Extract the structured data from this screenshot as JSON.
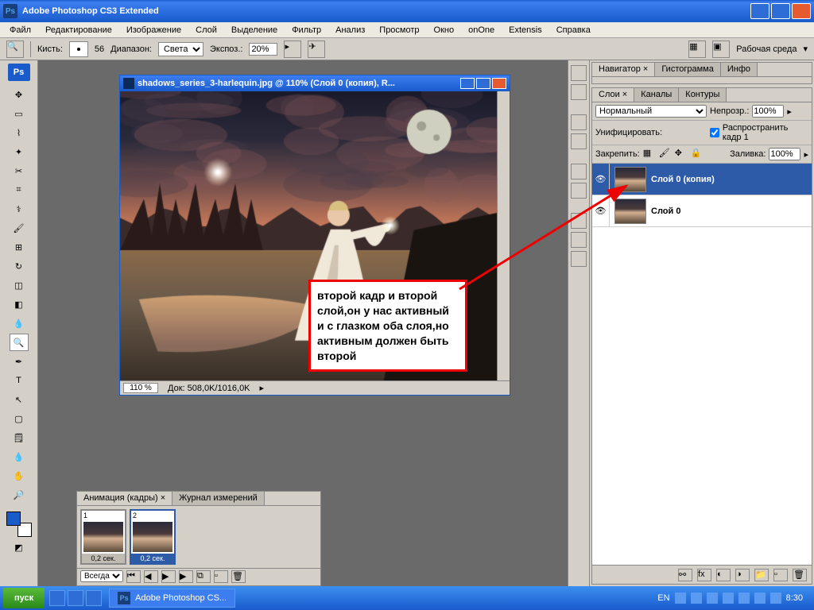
{
  "titlebar": {
    "app_name": "Adobe Photoshop CS3 Extended"
  },
  "menu": [
    "Файл",
    "Редактирование",
    "Изображение",
    "Слой",
    "Выделение",
    "Фильтр",
    "Анализ",
    "Просмотр",
    "Окно",
    "onOne",
    "Extensis",
    "Справка"
  ],
  "options": {
    "brush_label": "Кисть:",
    "brush_size": "56",
    "range_label": "Диапазон:",
    "range_value": "Света",
    "exposure_label": "Экспоз.:",
    "exposure_value": "20%",
    "workspace": "Рабочая среда"
  },
  "doc": {
    "title": "shadows_series_3-harlequin.jpg @ 110% (Слой 0 (копия), R...",
    "zoom": "110 %",
    "status": "Док: 508,0K/1016,0K"
  },
  "annotation": "второй кадр и второй слой,он у нас активный и с глазком оба слоя,но активным должен быть второй",
  "nav_tabs": [
    "Навигатор",
    "Гистограмма",
    "Инфо"
  ],
  "layers": {
    "tabs": [
      "Слои",
      "Каналы",
      "Контуры"
    ],
    "blend": "Нормальный",
    "opacity_label": "Непрозр.:",
    "opacity": "100%",
    "unify_label": "Унифицировать:",
    "propagate_label": "Распространить кадр 1",
    "lock_label": "Закрепить:",
    "fill_label": "Заливка:",
    "fill": "100%",
    "items": [
      {
        "name": "Слой 0 (копия)",
        "active": true
      },
      {
        "name": "Слой 0",
        "active": false
      }
    ]
  },
  "animation": {
    "tabs": [
      "Анимация (кадры)",
      "Журнал измерений"
    ],
    "loop": "Всегда",
    "frames": [
      {
        "num": "1",
        "dur": "0,2 сек.",
        "selected": false
      },
      {
        "num": "2",
        "dur": "0,2 сек.",
        "selected": true
      }
    ]
  },
  "taskbar": {
    "start": "пуск",
    "task": "Adobe Photoshop CS...",
    "lang": "EN",
    "time": "8:30"
  }
}
